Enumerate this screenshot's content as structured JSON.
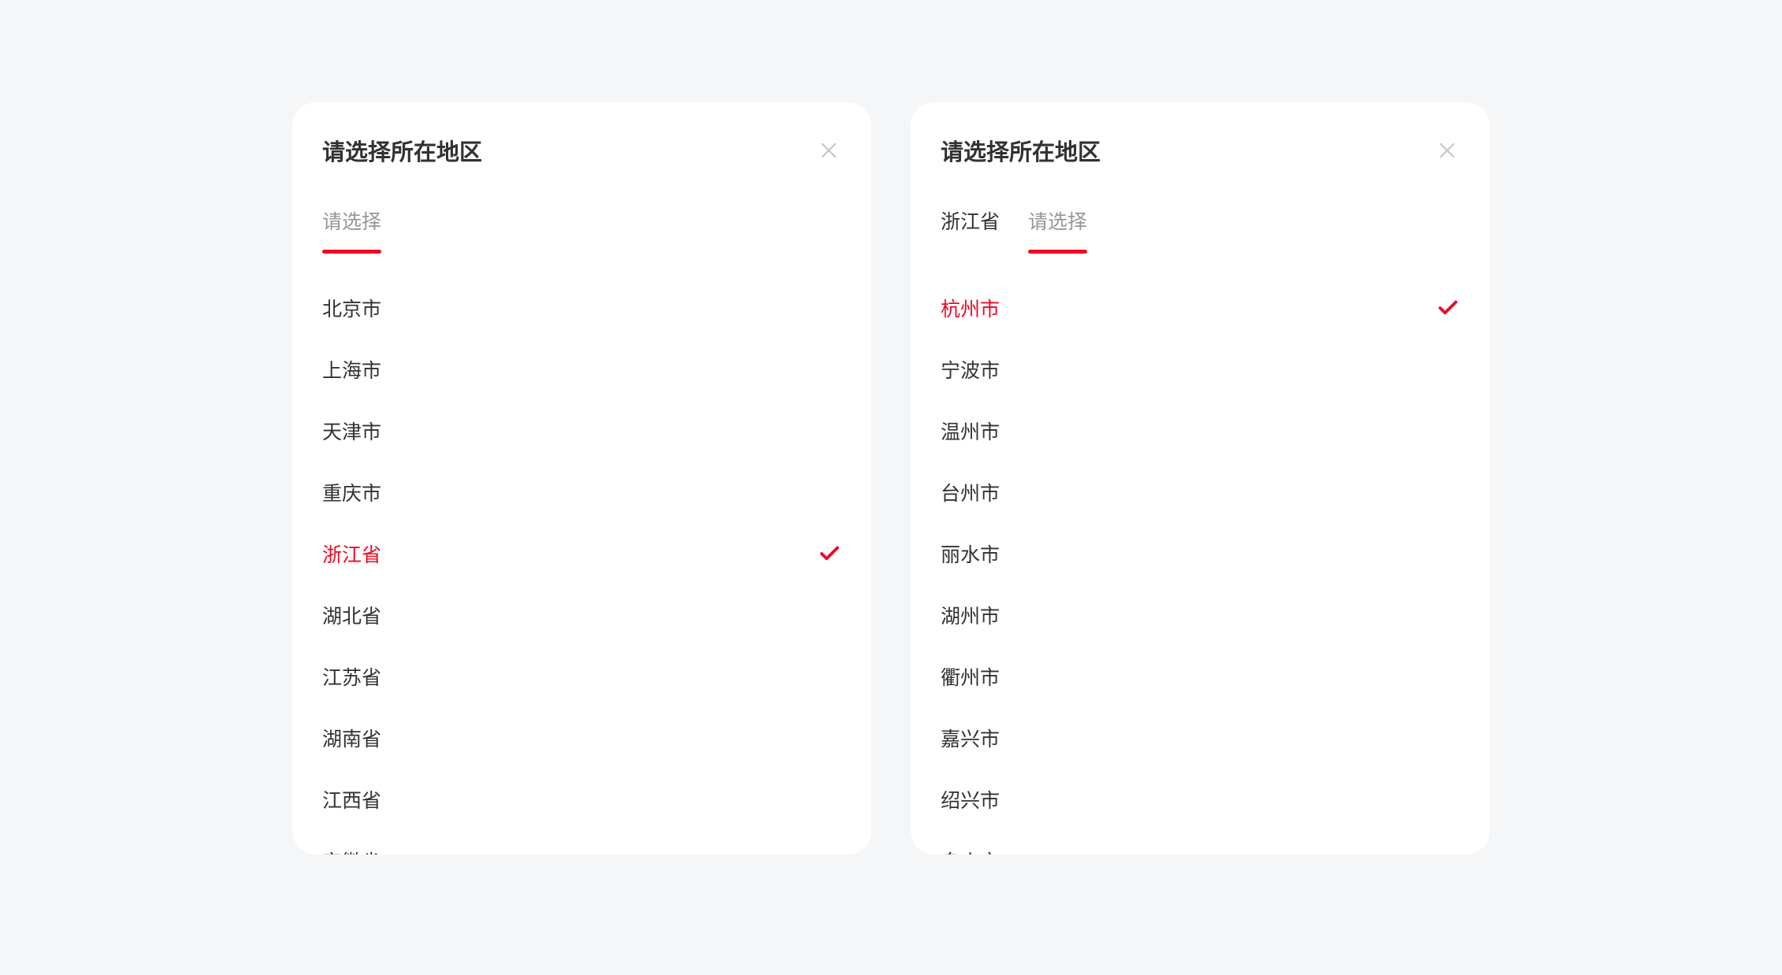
{
  "colors": {
    "accent": "#ee0a24",
    "text_primary": "#323233",
    "text_secondary": "#969799",
    "close_icon": "#c8c9cc",
    "background": "#f5f6f8",
    "panel_bg": "#ffffff"
  },
  "panel_left": {
    "title": "请选择所在地区",
    "tabs": [
      {
        "label": "请选择",
        "is_active_indicator": true,
        "is_selected_style": false
      }
    ],
    "options": [
      {
        "label": "北京市",
        "selected": false
      },
      {
        "label": "上海市",
        "selected": false
      },
      {
        "label": "天津市",
        "selected": false
      },
      {
        "label": "重庆市",
        "selected": false
      },
      {
        "label": "浙江省",
        "selected": true
      },
      {
        "label": "湖北省",
        "selected": false
      },
      {
        "label": "江苏省",
        "selected": false
      },
      {
        "label": "湖南省",
        "selected": false
      },
      {
        "label": "江西省",
        "selected": false
      },
      {
        "label": "安徽省",
        "selected": false
      }
    ]
  },
  "panel_right": {
    "title": "请选择所在地区",
    "tabs": [
      {
        "label": "浙江省",
        "is_active_indicator": false,
        "is_selected_style": true
      },
      {
        "label": "请选择",
        "is_active_indicator": true,
        "is_selected_style": false
      }
    ],
    "options": [
      {
        "label": "杭州市",
        "selected": true
      },
      {
        "label": "宁波市",
        "selected": false
      },
      {
        "label": "温州市",
        "selected": false
      },
      {
        "label": "台州市",
        "selected": false
      },
      {
        "label": "丽水市",
        "selected": false
      },
      {
        "label": "湖州市",
        "selected": false
      },
      {
        "label": "衢州市",
        "selected": false
      },
      {
        "label": "嘉兴市",
        "selected": false
      },
      {
        "label": "绍兴市",
        "selected": false
      },
      {
        "label": "舟山市",
        "selected": false
      }
    ]
  }
}
